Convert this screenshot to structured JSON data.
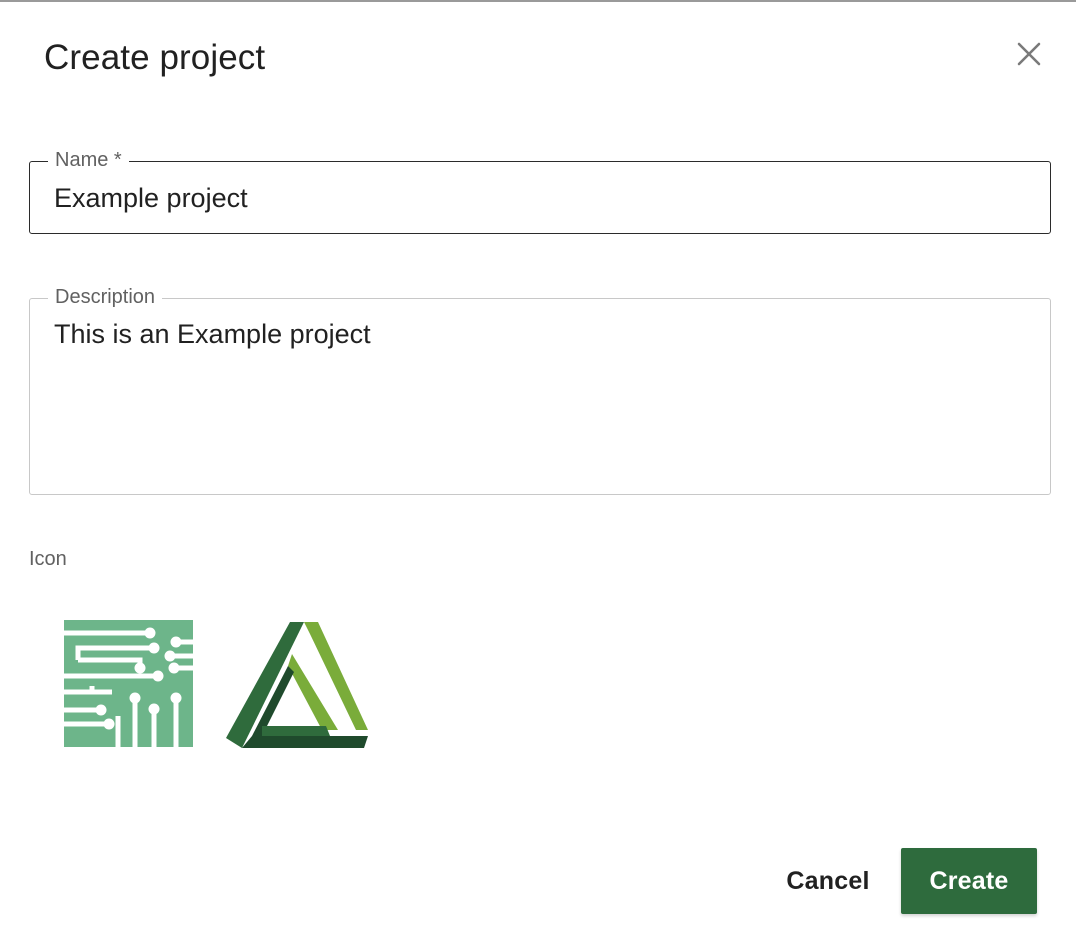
{
  "dialog": {
    "title": "Create project",
    "close_icon": "close-icon"
  },
  "form": {
    "name": {
      "label": "Name *",
      "value": "Example project"
    },
    "description": {
      "label": "Description",
      "value": "This is an Example project"
    },
    "icon": {
      "label": "Icon",
      "options": [
        {
          "icon": "circuit-board-icon",
          "color": "#6db58a"
        },
        {
          "icon": "penrose-triangle-icon",
          "colors": [
            "#1f4a2c",
            "#2f6b3c",
            "#7aac3a"
          ]
        }
      ]
    }
  },
  "actions": {
    "cancel_label": "Cancel",
    "create_label": "Create",
    "create_color": "#2e6b3d"
  }
}
